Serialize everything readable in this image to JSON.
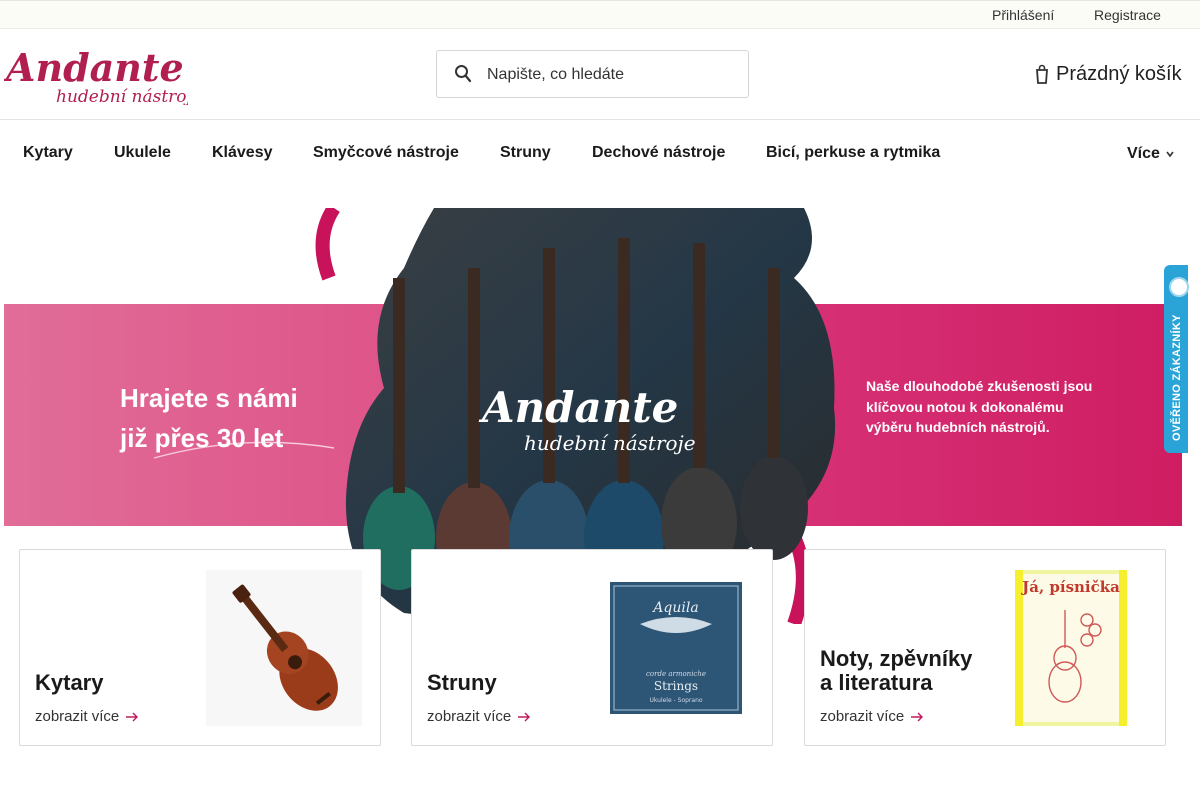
{
  "topbar": {
    "login": "Přihlášení",
    "register": "Registrace"
  },
  "header": {
    "logo": {
      "name": "Andante",
      "subtitle": "hudební nástroje"
    },
    "search": {
      "placeholder": "Napište, co hledáte"
    },
    "cart": {
      "label": "Prázdný košík"
    }
  },
  "nav": {
    "items": [
      "Kytary",
      "Ukulele",
      "Klávesy",
      "Smyčcové nástroje",
      "Struny",
      "Dechové nástroje",
      "Bicí, perkuse a rytmika"
    ],
    "more": "Více"
  },
  "hero": {
    "tagline": [
      "Hrajete s námi",
      "již přes 30 let"
    ],
    "logo": {
      "name": "Andante",
      "subtitle": "hudební nástroje"
    },
    "promo": "Naše dlouhodobé zkušenosti jsou klíčovou notou k dokonalému výběru hudebních nástrojů."
  },
  "trust_badge": {
    "label": "OVĚŘENO ZÁKAZNÍKY"
  },
  "categories": [
    {
      "title": "Kytary",
      "link": "zobrazit více"
    },
    {
      "title": "Struny",
      "link": "zobrazit více",
      "product_text": {
        "brand": "Aquila",
        "line1": "Strings",
        "line2": "corde armoniche",
        "line3": "Ukulele - Soprano"
      }
    },
    {
      "title": "Noty, zpěvníky\na literatura",
      "link": "zobrazit více",
      "product_text": {
        "book_title": "Já, písnička"
      }
    }
  ],
  "colors": {
    "brand": "#b01f4f",
    "band_start": "#e16d98",
    "band_end": "#cf1d62",
    "trust": "#2aa4d6",
    "arrow": "#c2185b"
  }
}
